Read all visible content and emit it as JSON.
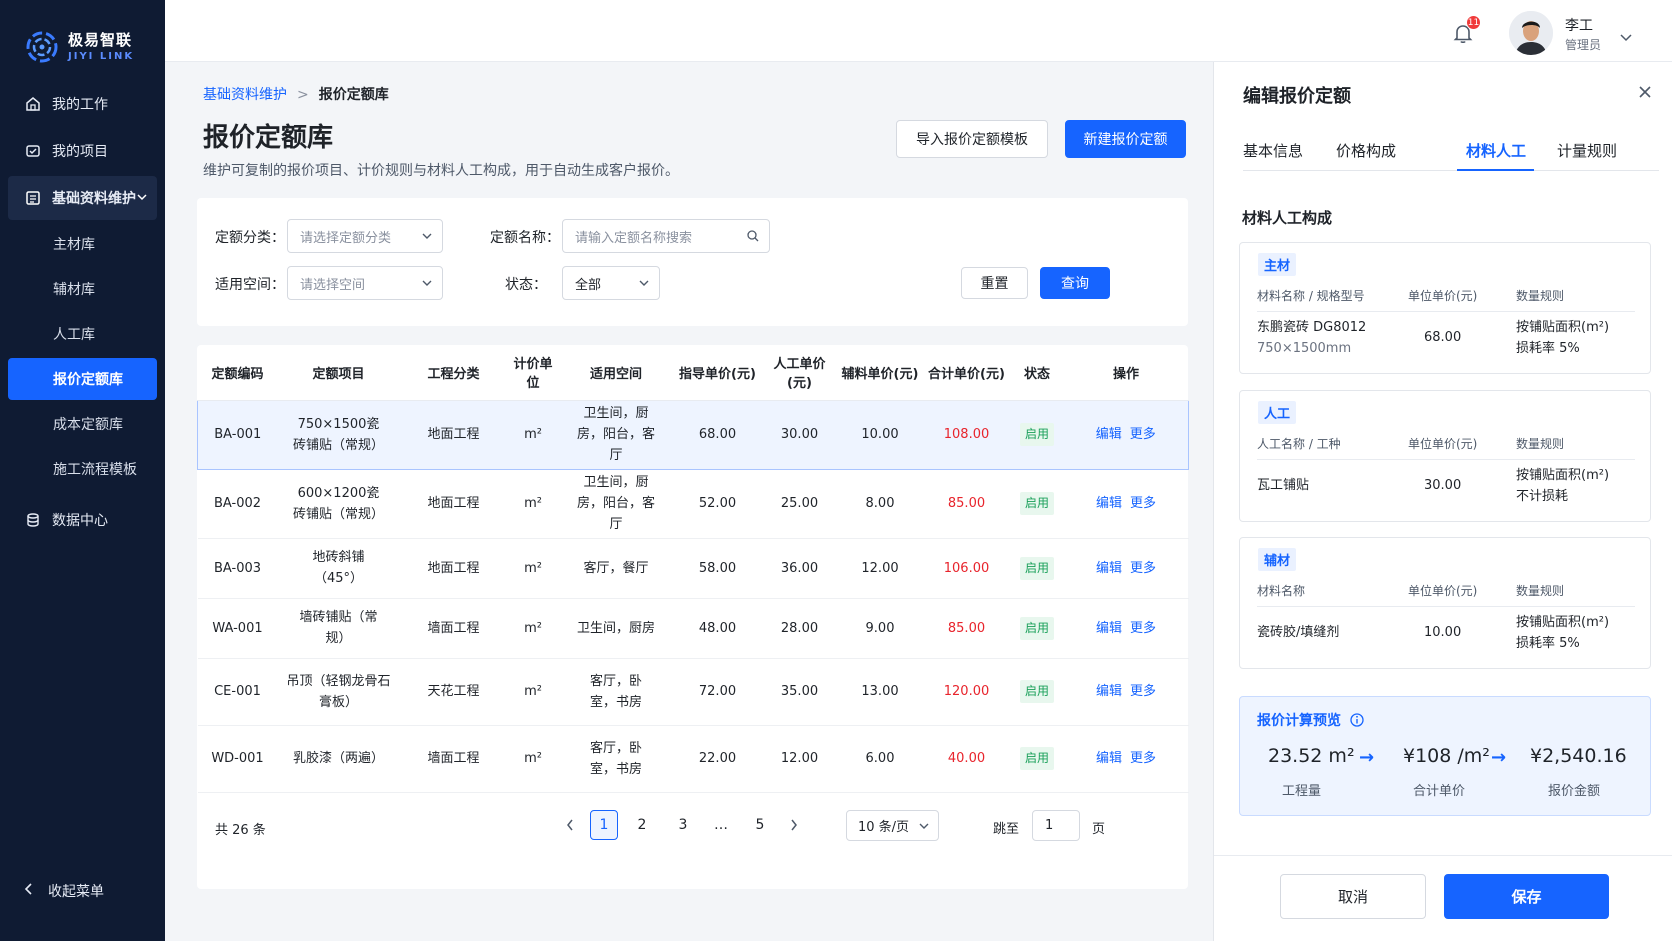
{
  "app": {
    "logo_cn": "极易智联",
    "logo_en": "JIYI LINK"
  },
  "sidebar": {
    "items": [
      {
        "label": "我的工作",
        "icon": "home-icon"
      },
      {
        "label": "我的项目",
        "icon": "project-icon"
      },
      {
        "label": "基础资料维护",
        "icon": "archive-icon"
      },
      {
        "label": "数据中心",
        "icon": "database-icon"
      }
    ],
    "sub_items": [
      "主材库",
      "辅材库",
      "人工库",
      "报价定额库",
      "成本定额库",
      "施工流程模板"
    ],
    "active_sub": "报价定额库",
    "collapse_label": "收起菜单"
  },
  "topbar": {
    "notification_count": "11",
    "user_name": "李工",
    "user_role": "管理员"
  },
  "breadcrumb": {
    "parent": "基础资料维护",
    "current": "报价定额库"
  },
  "page": {
    "title": "报价定额库",
    "description": "维护可复制的报价项目、计价规则与材料人工构成，用于自动生成客户报价。",
    "import_button": "导入报价定额模板",
    "new_button": "新建报价定额"
  },
  "filter": {
    "category_label": "定额分类：",
    "category_placeholder": "请选择定额分类",
    "name_label": "定额名称：",
    "name_placeholder": "请输入定额名称搜索",
    "space_label": "适用空间：",
    "space_placeholder": "请选择空间",
    "status_label": "状态：",
    "status_value": "全部",
    "reset_button": "重置",
    "query_button": "查询"
  },
  "table": {
    "columns": [
      "定额编码",
      "定额项目",
      "工程分类",
      "计价单位",
      "适用空间",
      "指导单价(元)",
      "人工单价(元)",
      "辅料单价(元)",
      "合计单价(元)",
      "状态",
      "操作"
    ],
    "rows": [
      {
        "code": "BA-001",
        "item": "750×1500瓷砖铺贴（常规）",
        "category": "地面工程",
        "unit": "m²",
        "space": "卫生间，厨房，阳台，客厅",
        "guide": "68.00",
        "labor": "30.00",
        "aux": "10.00",
        "total": "108.00",
        "status": "启用",
        "edit": "编辑",
        "more": "更多"
      },
      {
        "code": "BA-002",
        "item": "600×1200瓷砖铺贴（常规）",
        "category": "地面工程",
        "unit": "m²",
        "space": "卫生间，厨房，阳台，客厅",
        "guide": "52.00",
        "labor": "25.00",
        "aux": "8.00",
        "total": "85.00",
        "status": "启用",
        "edit": "编辑",
        "more": "更多"
      },
      {
        "code": "BA-003",
        "item": "地砖斜铺（45°）",
        "category": "地面工程",
        "unit": "m²",
        "space": "客厅，餐厅",
        "guide": "58.00",
        "labor": "36.00",
        "aux": "12.00",
        "total": "106.00",
        "status": "启用",
        "edit": "编辑",
        "more": "更多"
      },
      {
        "code": "WA-001",
        "item": "墙砖铺贴（常规）",
        "category": "墙面工程",
        "unit": "m²",
        "space": "卫生间，厨房",
        "guide": "48.00",
        "labor": "28.00",
        "aux": "9.00",
        "total": "85.00",
        "status": "启用",
        "edit": "编辑",
        "more": "更多"
      },
      {
        "code": "CE-001",
        "item": "吊顶（轻钢龙骨石膏板）",
        "category": "天花工程",
        "unit": "m²",
        "space": "客厅，卧室，书房",
        "guide": "72.00",
        "labor": "35.00",
        "aux": "13.00",
        "total": "120.00",
        "status": "启用",
        "edit": "编辑",
        "more": "更多"
      },
      {
        "code": "WD-001",
        "item": "乳胶漆（两遍）",
        "category": "墙面工程",
        "unit": "m²",
        "space": "客厅，卧室，书房",
        "guide": "22.00",
        "labor": "12.00",
        "aux": "6.00",
        "total": "40.00",
        "status": "启用",
        "edit": "编辑",
        "more": "更多"
      }
    ]
  },
  "pagination": {
    "total_text": "共 26 条",
    "pages": [
      "1",
      "2",
      "3",
      "…",
      "5"
    ],
    "current": "1",
    "page_size": "10 条/页",
    "jump_label": "跳至",
    "jump_value": "1",
    "page_suffix": "页"
  },
  "panel": {
    "title": "编辑报价定额",
    "tabs": [
      "基本信息",
      "价格构成",
      "材料人工",
      "计量规则"
    ],
    "active_tab": "材料人工",
    "section_title": "材料人工构成",
    "main_material": {
      "label": "主材",
      "headers": [
        "材料名称 / 规格型号",
        "单位单价(元)",
        "数量规则"
      ],
      "name": "东鹏瓷砖 DG8012",
      "spec": "750×1500mm",
      "price": "68.00",
      "rule_line1": "按铺贴面积(m²)",
      "rule_line2": "损耗率 5%"
    },
    "labor": {
      "label": "人工",
      "headers": [
        "人工名称 / 工种",
        "单位单价(元)",
        "数量规则"
      ],
      "name": "瓦工铺贴",
      "price": "30.00",
      "rule_line1": "按铺贴面积(m²)",
      "rule_line2": "不计损耗"
    },
    "aux_material": {
      "label": "辅材",
      "headers": [
        "材料名称",
        "单位单价(元)",
        "数量规则"
      ],
      "name": "瓷砖胶/填缝剂",
      "price": "10.00",
      "rule_line1": "按铺贴面积(m²)",
      "rule_line2": "损耗率 5%"
    },
    "preview": {
      "title": "报价计算预览",
      "quantity": "23.52 m²",
      "quantity_label": "工程量",
      "unit_price": "¥108 /m²",
      "unit_price_label": "合计单价",
      "amount": "¥2,540.16",
      "amount_label": "报价金额"
    },
    "cancel_button": "取消",
    "save_button": "保存"
  },
  "colors": {
    "primary": "#1664ff",
    "sidebar_bg": "#0f1b33",
    "danger": "#e8242c",
    "success": "#1aa05a"
  }
}
